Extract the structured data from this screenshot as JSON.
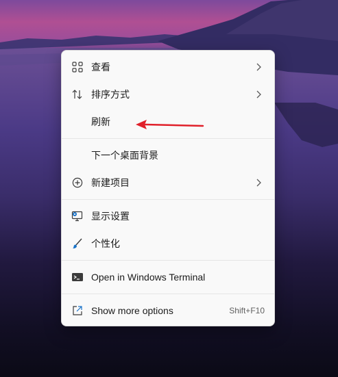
{
  "context_menu": {
    "items": [
      {
        "label": "查看",
        "icon": "grid-icon",
        "has_submenu": true
      },
      {
        "label": "排序方式",
        "icon": "sort-arrows-icon",
        "has_submenu": true
      },
      {
        "label": "刷新",
        "icon": "",
        "has_submenu": false
      },
      {
        "label": "下一个桌面背景",
        "icon": "",
        "has_submenu": false
      },
      {
        "label": "新建项目",
        "icon": "plus-circle-icon",
        "has_submenu": true
      },
      {
        "label": "显示设置",
        "icon": "display-settings-icon",
        "has_submenu": false
      },
      {
        "label": "个性化",
        "icon": "brush-icon",
        "has_submenu": false
      },
      {
        "label": "Open in Windows Terminal",
        "icon": "terminal-icon",
        "has_submenu": false
      },
      {
        "label": "Show more options",
        "icon": "share-external-icon",
        "has_submenu": false,
        "shortcut": "Shift+F10"
      }
    ]
  },
  "annotation": {
    "icon": "red-arrow-icon",
    "color": "#e0202a",
    "points_to": "刷新"
  },
  "colors": {
    "menu_bg": "#f9f9f9",
    "text": "#1b1b1b",
    "accent_blue": "#1a73c8"
  }
}
